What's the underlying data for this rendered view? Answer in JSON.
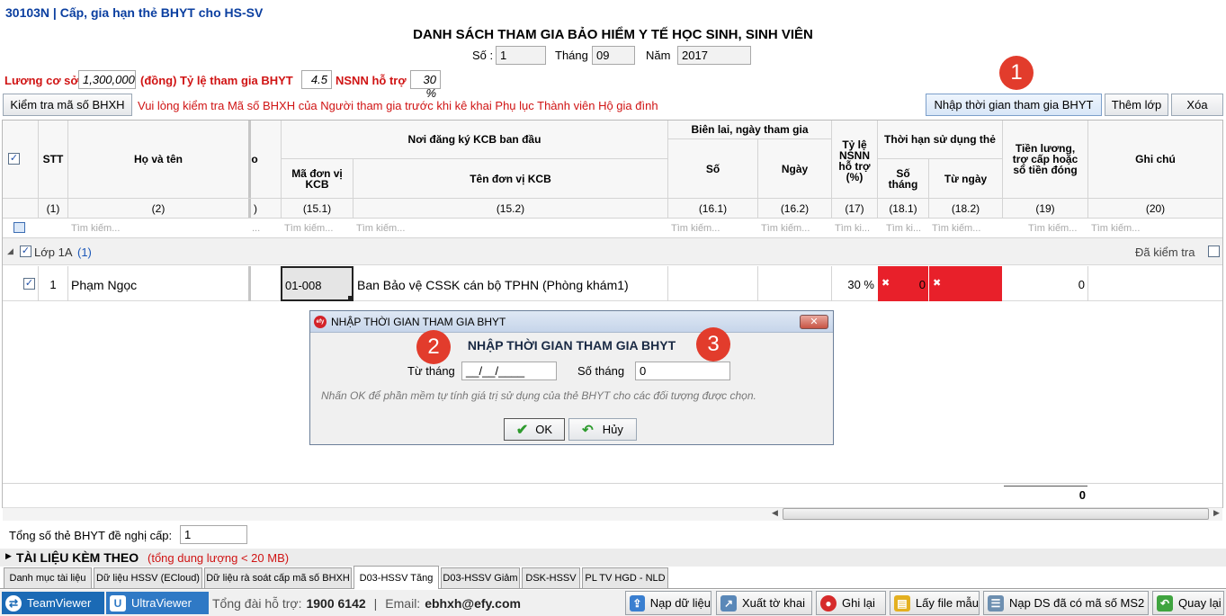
{
  "window_title": "30103N | Cấp, gia hạn thẻ BHYT cho HS-SV",
  "main_title": "DANH SÁCH THAM GIA BẢO HIỂM Y TẾ HỌC SINH, SINH VIÊN",
  "header": {
    "so_label": "Số :",
    "so_value": "1",
    "thang_label": "Tháng",
    "thang_value": "09",
    "nam_label": "Năm",
    "nam_value": "2017"
  },
  "params": {
    "luong_label": "Lương cơ sở",
    "luong_value": "1,300,000",
    "dong_label": "(đồng) Tỷ lệ tham gia BHYT",
    "tyle_value": "4.5",
    "nsnn_label": "NSNN hỗ trợ",
    "nsnn_value": "30 %"
  },
  "toolbar": {
    "check_btn": "Kiểm tra mã số BHXH",
    "warning": "Vui lòng kiểm tra Mã số BHXH của Người tham gia trước khi kê khai Phụ lục Thành viên Hộ gia đình",
    "nhap_btn": "Nhập thời gian tham gia BHYT",
    "them_lop_btn": "Thêm lớp",
    "xoa_btn": "Xóa"
  },
  "badges": {
    "b1": "1",
    "b2": "2",
    "b3": "3"
  },
  "grid": {
    "headers": {
      "stt": "STT",
      "ho_ten": "Họ và tên",
      "cut": "o",
      "noi_dk": "Nơi đăng ký KCB ban đầu",
      "ma_don_vi": "Mã đơn vị KCB",
      "ten_don_vi": "Tên đơn vị KCB",
      "bien_lai": "Biên lai, ngày tham gia",
      "so": "Số",
      "ngay": "Ngày",
      "ty_le": "Tỷ lệ NSNN hỗ trợ (%)",
      "thoi_han": "Thời hạn sử dụng thẻ",
      "so_thang": "Số tháng",
      "tu_ngay": "Từ ngày",
      "tien_luong": "Tiền lương, trợ cấp hoặc số tiền đóng",
      "ghi_chu": "Ghi chú"
    },
    "indices": {
      "stt": "(1)",
      "ho_ten": "(2)",
      "cut": ")",
      "ma": "(15.1)",
      "ten": "(15.2)",
      "so": "(16.1)",
      "ngay": "(16.2)",
      "tyle": "(17)",
      "sothang": "(18.1)",
      "tungay": "(18.2)",
      "tien": "(19)",
      "ghichu": "(20)"
    },
    "search": {
      "full": "Tìm kiếm...",
      "short_ki": "Tìm ki...",
      "dots": "..."
    },
    "group_label": "Lớp 1A",
    "group_count": "(1)",
    "checked_label": "Đã kiểm tra",
    "row": {
      "stt": "1",
      "name": "Phạm Ngọc",
      "ma": "01-008",
      "ten": "Ban Bảo vệ CSSK cán bộ TPHN (Phòng khám1)",
      "tyle": "30 %",
      "sothang": "0",
      "tien": "0"
    },
    "footer_total": "0"
  },
  "dialog": {
    "title": "NHẬP THỜI GIAN THAM GIA BHYT",
    "heading": "NHẬP THỜI GIAN THAM GIA BHYT",
    "tu_thang_label": "Từ tháng",
    "tu_thang_value": "__/__/____",
    "so_thang_label": "Số tháng",
    "so_thang_value": "0",
    "note": "Nhấn OK để phần mềm tự tính giá trị sử dụng của thẻ BHYT cho các đối tượng được chọn.",
    "ok": "OK",
    "huy": "Hủy"
  },
  "summary": {
    "tong_label": "Tổng số thẻ BHYT đề nghị cấp:",
    "tong_value": "1",
    "tai_lieu": "TÀI LIỆU KÈM THEO",
    "tai_lieu_note": "(tổng dung lượng < 20 MB)"
  },
  "tabs": [
    "Danh mục tài liệu",
    "Dữ liệu HSSV (ECloud)",
    "Dữ liệu rà soát cấp mã số BHXH",
    "D03-HSSV Tăng",
    "D03-HSSV Giảm",
    "DSK-HSSV",
    "PL TV HGD - NLD"
  ],
  "statusbar": {
    "teamviewer": "TeamViewer",
    "ultraviewer": "UltraViewer",
    "hotline_label": "Tổng đài hỗ trợ:",
    "hotline": "1900 6142",
    "email_label": "Email:",
    "email": "ebhxh@efy.com",
    "nap_du_lieu": "Nạp dữ liệu",
    "xuat_to_khai": "Xuất tờ khai",
    "ghi_lai": "Ghi lại",
    "lay_file_mau": "Lấy file mẫu",
    "nap_ds": "Nạp DS đã có mã số MS2",
    "quay_lai": "Quay lại"
  },
  "colors": {
    "red_cell": "#e8202a",
    "accent_blue": "#0b3fa0",
    "warning_red": "#d01414"
  }
}
